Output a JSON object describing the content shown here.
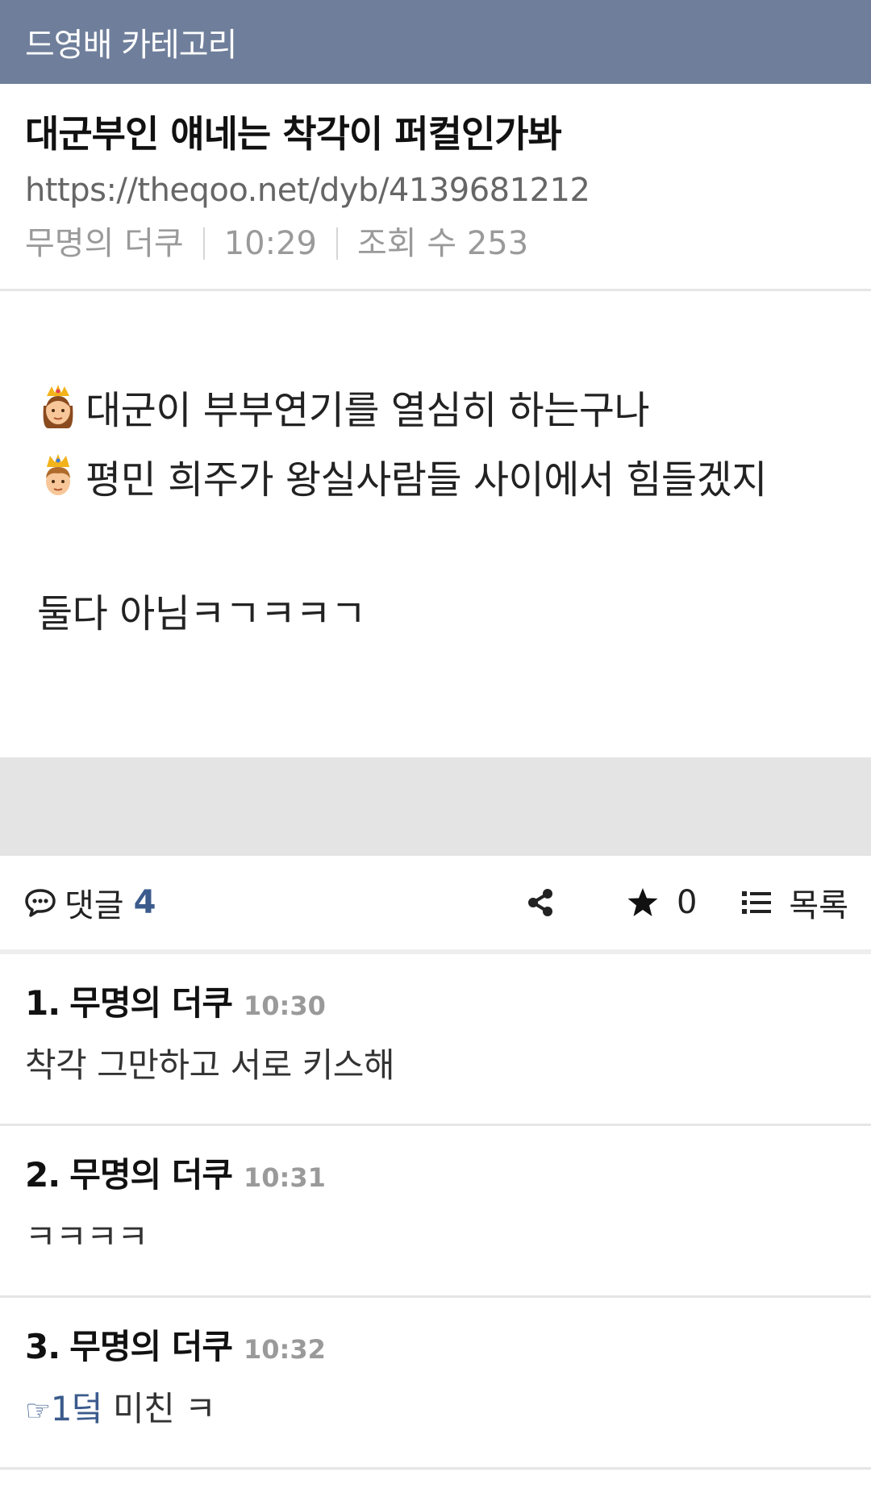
{
  "topbar": {
    "title": "드영배 카테고리"
  },
  "post": {
    "title": "대군부인 얘네는 착각이 퍼컬인가봐",
    "url": "https://theqoo.net/dyb/4139681212",
    "author": "무명의 더쿠",
    "time": "10:29",
    "views_label": "조회 수 253",
    "lines": [
      {
        "emoji": "princess-emoji",
        "text": "대군이 부부연기를 열심히 하는구나"
      },
      {
        "emoji": "prince-emoji",
        "text": "평민 희주가 왕실사람들 사이에서 힘들겠지"
      },
      {
        "emoji": "",
        "text": "둘다 아님ㅋㄱㅋㅋㄱ"
      }
    ]
  },
  "comment_bar": {
    "label": "댓글",
    "count": "4",
    "star_count": "0",
    "list_label": "목록",
    "icons": [
      "speech-bubble-icon",
      "share-icon",
      "star-icon",
      "list-icon"
    ]
  },
  "comments": [
    {
      "num": "1.",
      "author": "무명의 더쿠",
      "time": "10:30",
      "text": "착각 그만하고 서로 키스해"
    },
    {
      "num": "2.",
      "author": "무명의 더쿠",
      "time": "10:31",
      "text": "ㅋㅋㅋㅋ"
    },
    {
      "num": "3.",
      "author": "무명의 더쿠",
      "time": "10:32",
      "reply_hand": "☞",
      "reply_ref": "1덬",
      "text": " 미친 ㅋ"
    }
  ],
  "colors": {
    "topbar": "#6f7f9b",
    "accent": "#3b5b8c",
    "band": "#e4e4e4"
  }
}
